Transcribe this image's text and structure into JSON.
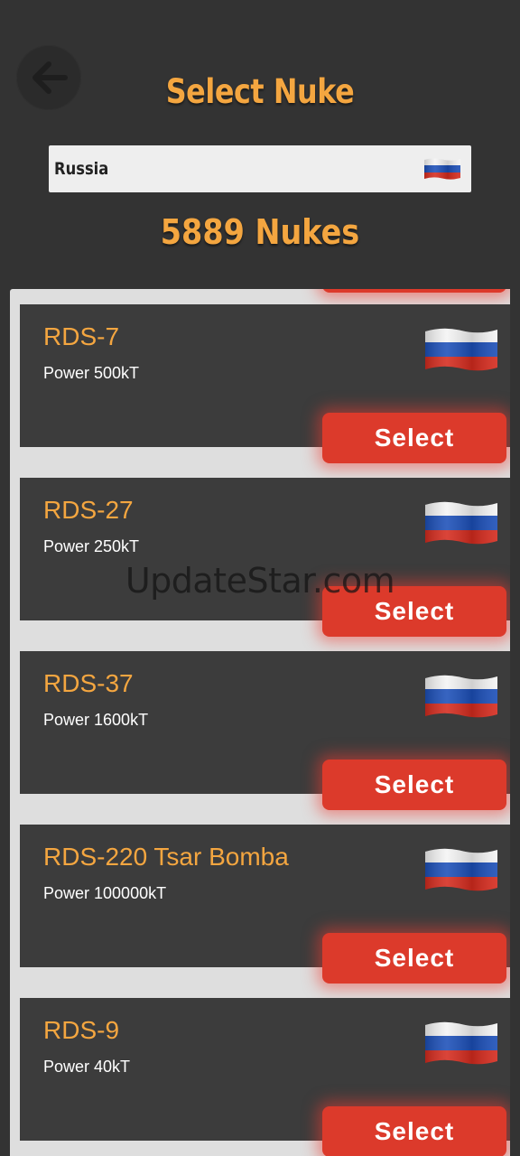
{
  "header": {
    "back_icon": "arrow-left-icon",
    "title": "Select Nuke"
  },
  "country_select": {
    "value": "Russia",
    "flag_icon": "russia-flag-icon"
  },
  "nuke_count": "5889 Nukes",
  "nukes": [
    {
      "name": "RDS-7",
      "power": "Power 500kT",
      "button": "Select"
    },
    {
      "name": "RDS-27",
      "power": "Power 250kT",
      "button": "Select"
    },
    {
      "name": "RDS-37",
      "power": "Power 1600kT",
      "button": "Select"
    },
    {
      "name": "RDS-220 Tsar Bomba",
      "power": "Power 100000kT",
      "button": "Select"
    },
    {
      "name": "RDS-9",
      "power": "Power 40kT",
      "button": "Select"
    }
  ],
  "watermark": "UpdateStar.com",
  "colors": {
    "background": "#333333",
    "card": "#3c3c3c",
    "accent": "#f4a640",
    "button": "#dc3a2b",
    "list_background": "#dedede"
  }
}
